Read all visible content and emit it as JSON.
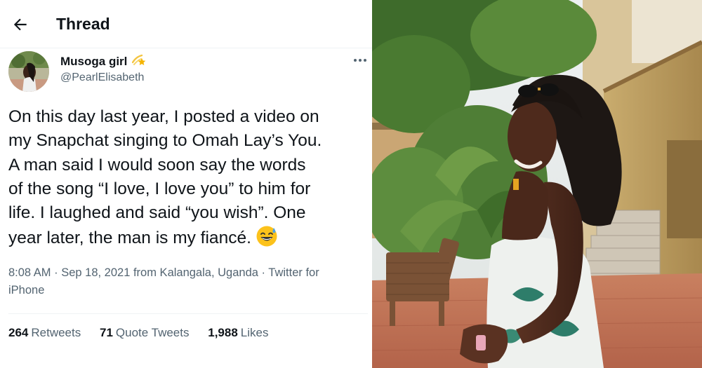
{
  "header": {
    "title": "Thread"
  },
  "icons": {
    "back": "back-arrow-icon",
    "more": "more-dots-icon",
    "name_badge": "shooting-star-emoji-icon",
    "tweet_emoji": "grinning-sweat-emoji-icon"
  },
  "tweet": {
    "display_name": "Musoga girl",
    "handle": "@PearlElisabeth",
    "text_lines": [
      "On this day last year, I posted a video on",
      "my Snapchat singing to Omah Lay’s You.",
      "A man said I would soon say the words",
      "of the song “I love, I love you” to him for",
      "life. I laughed and said “you wish”. One",
      "year later, the man is my fiancé."
    ],
    "time": "8:08 AM",
    "sep1": " · ",
    "date": "Sep 18, 2021",
    "location": " from Kalangala, Uganda",
    "sep2": " · ",
    "source_line1": "Twitter for",
    "source_line2": "iPhone"
  },
  "stats": {
    "retweets_count": "264",
    "retweets_label": "Retweets",
    "quotes_count": "71",
    "quotes_label": "Quote Tweets",
    "likes_count": "1,988",
    "likes_label": "Likes"
  },
  "colors": {
    "text": "#0f1419",
    "secondary": "#536471",
    "divider": "#eff3f4",
    "background": "#ffffff"
  }
}
